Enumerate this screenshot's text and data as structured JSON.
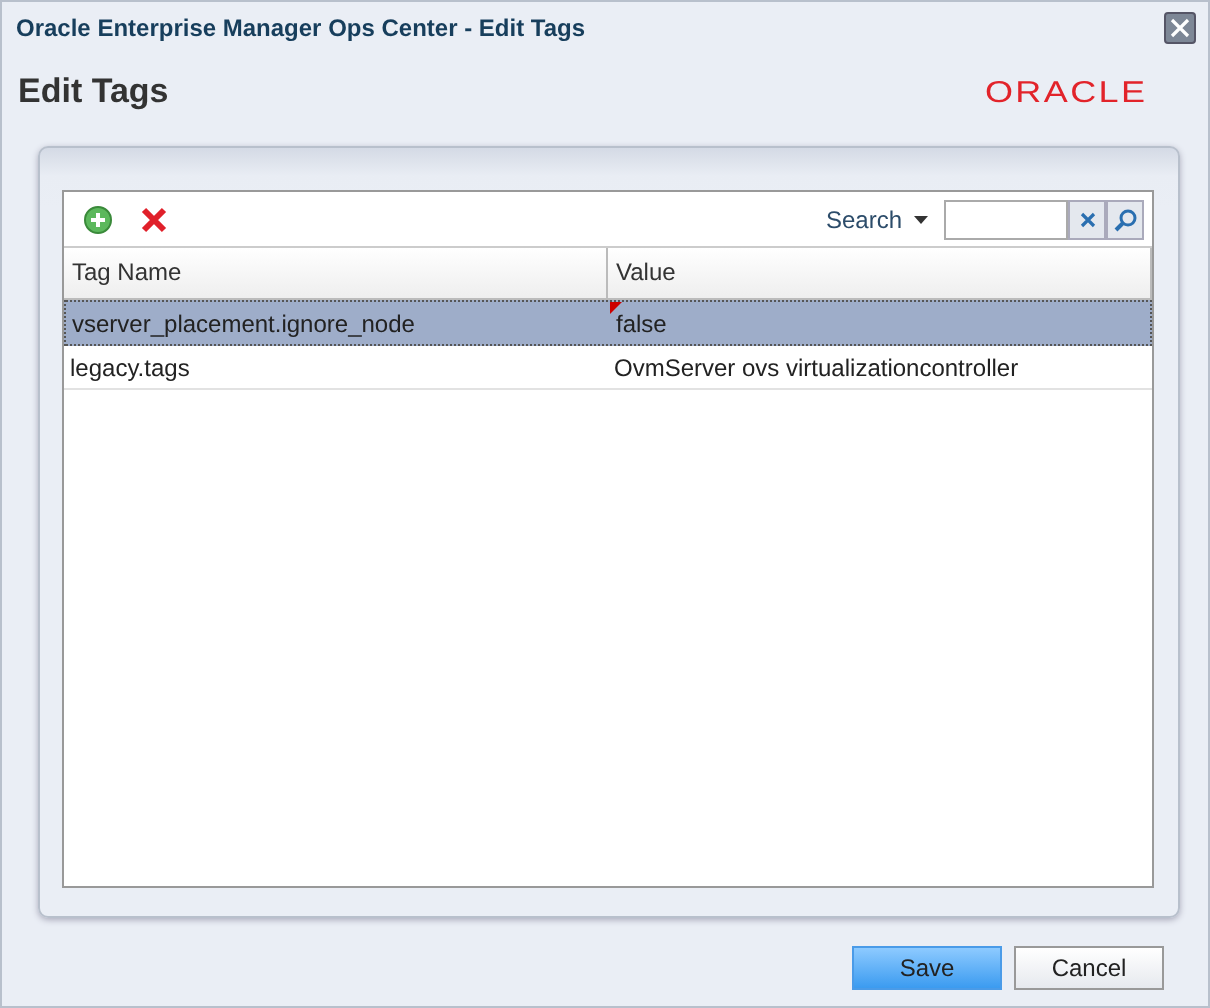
{
  "window": {
    "title": "Oracle Enterprise Manager Ops Center - Edit Tags"
  },
  "header": {
    "title": "Edit Tags",
    "logo": "ORACLE"
  },
  "toolbar": {
    "search_label": "Search"
  },
  "table": {
    "columns": [
      "Tag Name",
      "Value"
    ],
    "rows": [
      {
        "name": "vserver_placement.ignore_node",
        "value": "false",
        "selected": true,
        "edited": true
      },
      {
        "name": "legacy.tags",
        "value": "OvmServer ovs virtualizationcontroller",
        "selected": false,
        "edited": false
      }
    ]
  },
  "buttons": [
    {
      "label": "Save",
      "kind": "primary"
    },
    {
      "label": "Cancel",
      "kind": "secondary"
    }
  ]
}
